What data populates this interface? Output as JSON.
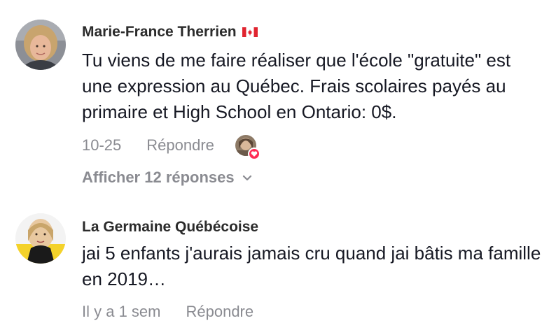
{
  "comments": [
    {
      "author": "Marie-France Therrien",
      "flag_icon": "canada-flag-icon",
      "text": "Tu viens de me faire réaliser que l'école \"gratuite\" est une expression au Québec. Frais scolaires payés au primaire et High School en Ontario: 0$.",
      "date": "10-25",
      "reply_label": "Répondre",
      "show_replies_label": "Afficher 12 réponses",
      "liked_by_author": true
    },
    {
      "author": "La Germaine Québécoise",
      "text": "jai 5 enfants j'aurais jamais cru quand jai bâtis ma famille en 2019…",
      "date": "Il y a 1 sem",
      "reply_label": "Répondre"
    }
  ],
  "colors": {
    "text": "#161823",
    "muted": "#8a8b91",
    "heart": "#fe2c55"
  }
}
